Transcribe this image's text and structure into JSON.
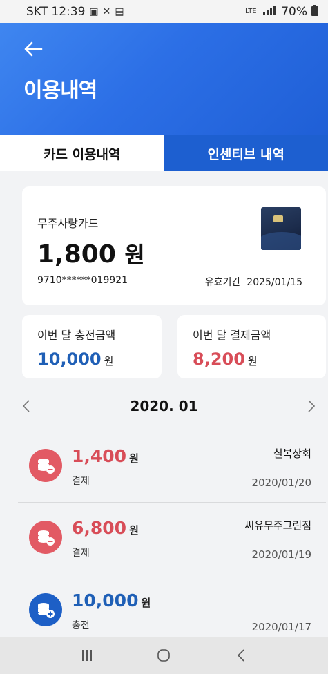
{
  "status_bar": {
    "carrier_time": "SKT 12:39",
    "battery": "70%"
  },
  "header": {
    "title": "이용내역",
    "back_icon": "arrow-left-icon"
  },
  "tabs": [
    {
      "label": "카드 이용내역",
      "active": true
    },
    {
      "label": "인센티브 내역",
      "active": false
    }
  ],
  "card": {
    "name": "무주사랑카드",
    "balance": "1,800",
    "balance_unit": "원",
    "number": "9710******019921",
    "expiry_label": "유효기간",
    "expiry_date": "2025/01/15"
  },
  "summary": {
    "charge_label": "이번 달 충전금액",
    "charge_value": "10,000",
    "pay_label": "이번 달 결제금액",
    "pay_value": "8,200",
    "unit": "원"
  },
  "month_nav": {
    "label": "2020. 01",
    "prev_icon": "chevron-left-icon",
    "next_icon": "chevron-right-icon"
  },
  "transactions": [
    {
      "amount": "1,400",
      "unit": "원",
      "type": "결제",
      "merchant": "칠복상회",
      "date": "2020/01/20",
      "kind": "pay"
    },
    {
      "amount": "6,800",
      "unit": "원",
      "type": "결제",
      "merchant": "씨유무주그린점",
      "date": "2020/01/19",
      "kind": "pay"
    },
    {
      "amount": "10,000",
      "unit": "원",
      "type": "충전",
      "merchant": "",
      "date": "2020/01/17",
      "kind": "charge"
    }
  ],
  "colors": {
    "header_blue": "#2c6fe6",
    "tab_blue": "#1d5fd0",
    "pay_red": "#d84d58",
    "charge_blue": "#1f5fb6"
  }
}
